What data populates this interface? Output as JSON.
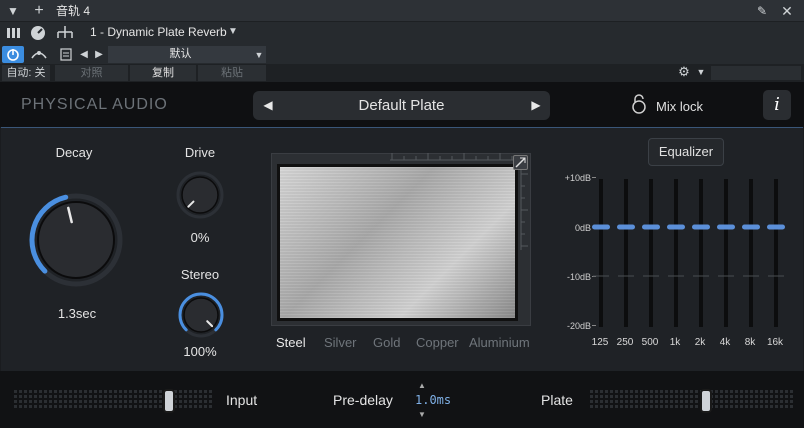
{
  "host": {
    "track_name": "音轨 4",
    "insert_name": "1 - Dynamic Plate Reverb",
    "preset_menu": "默认",
    "auto_label": "自动: 关",
    "compare_label": "对照",
    "copy_label": "复制",
    "paste_label": "粘贴"
  },
  "plugin": {
    "brand": "PHYSICAL AUDIO",
    "preset": "Default Plate",
    "mix_lock": "Mix lock",
    "info": "i"
  },
  "knobs": {
    "decay": {
      "label": "Decay",
      "value": "1.3sec",
      "level": 0.45
    },
    "drive": {
      "label": "Drive",
      "value": "0%",
      "level": 0.0
    },
    "stereo": {
      "label": "Stereo",
      "value": "100%",
      "level": 1.0
    }
  },
  "materials": [
    "Steel",
    "Silver",
    "Gold",
    "Copper",
    "Aluminium"
  ],
  "selected_material": "Steel",
  "equalizer": {
    "label": "Equalizer",
    "db_labels": [
      "+10dB",
      "0dB",
      "-10dB",
      "-20dB"
    ],
    "bands": [
      "125",
      "250",
      "500",
      "1k",
      "2k",
      "4k",
      "8k",
      "16k"
    ],
    "gains_db": [
      0,
      0,
      0,
      0,
      0,
      0,
      0,
      0
    ]
  },
  "bottom": {
    "input": "Input",
    "predelay_label": "Pre-delay",
    "predelay_value": "1.0ms",
    "plate": "Plate"
  },
  "colors": {
    "accent": "#4a8fe0",
    "eq_handle": "#5b8fd8"
  }
}
